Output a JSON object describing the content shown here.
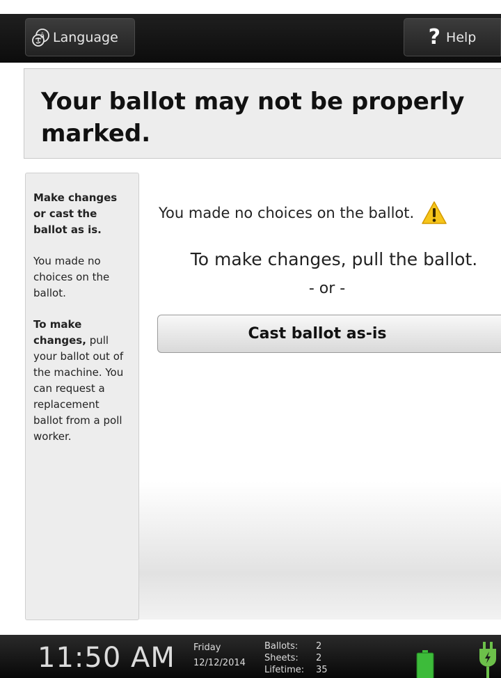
{
  "header": {
    "language_label": "Language",
    "language_icon_glyph": "â",
    "help_glyph": "?",
    "help_label": "Help"
  },
  "title": "Your ballot may not be properly marked.",
  "sidebar": {
    "heading": "Make changes or cast the ballot as is.",
    "para1": "You made no choices on the ballot.",
    "para2_bold": "To make changes,",
    "para2_rest": " pull your ballot out of the machine. You can request a replacement ballot from a poll worker."
  },
  "main": {
    "no_choices_msg": "You made no choices on the ballot.",
    "pull_msg": "To make changes, pull the ballot.",
    "or_text": "- or -",
    "cast_button_label": "Cast ballot as-is"
  },
  "status": {
    "time": "11:50 AM",
    "day": "Friday",
    "date": "12/12/2014",
    "ballots_label": "Ballots:",
    "ballots_value": "2",
    "sheets_label": "Sheets:",
    "sheets_value": "2",
    "lifetime_label": "Lifetime:",
    "lifetime_value": "35"
  },
  "colors": {
    "warning": "#f6c51a",
    "battery": "#3dbb3a",
    "plug": "#6cc04a"
  },
  "icons": [
    "language-icon",
    "help-icon",
    "warning-icon",
    "battery-icon",
    "power-plug-icon"
  ]
}
